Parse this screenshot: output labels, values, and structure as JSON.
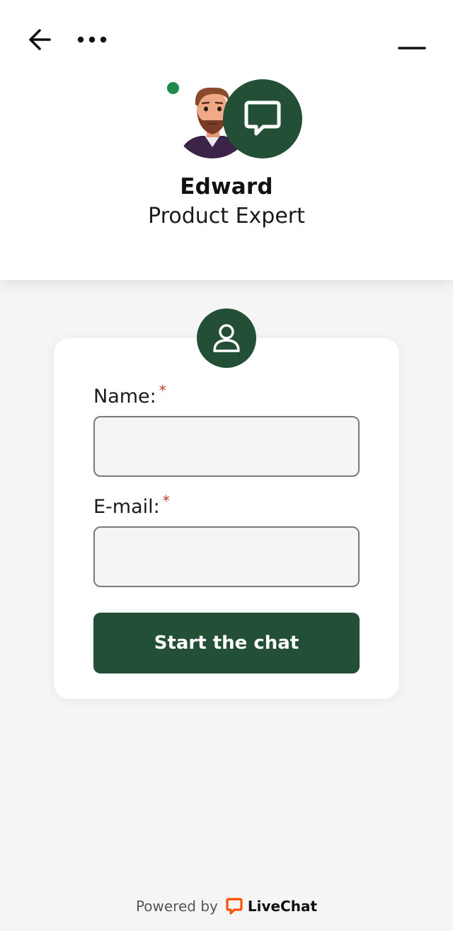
{
  "header": {
    "agent_name": "Edward",
    "agent_role": "Product Expert",
    "status": "online",
    "status_color": "#1f8a4c",
    "brand_color": "#244f37"
  },
  "form": {
    "name_label": "Name:",
    "name_required": "*",
    "name_value": "",
    "email_label": "E-mail:",
    "email_required": "*",
    "email_value": "",
    "submit_label": "Start the chat"
  },
  "footer": {
    "powered_by": "Powered by",
    "brand_name": "LiveChat",
    "brand_color": "#ff5100"
  },
  "icons": {
    "back": "arrow-left-icon",
    "more": "more-horizontal-icon",
    "minimize": "minimize-icon",
    "chat": "chat-bubble-icon",
    "user": "user-icon"
  }
}
